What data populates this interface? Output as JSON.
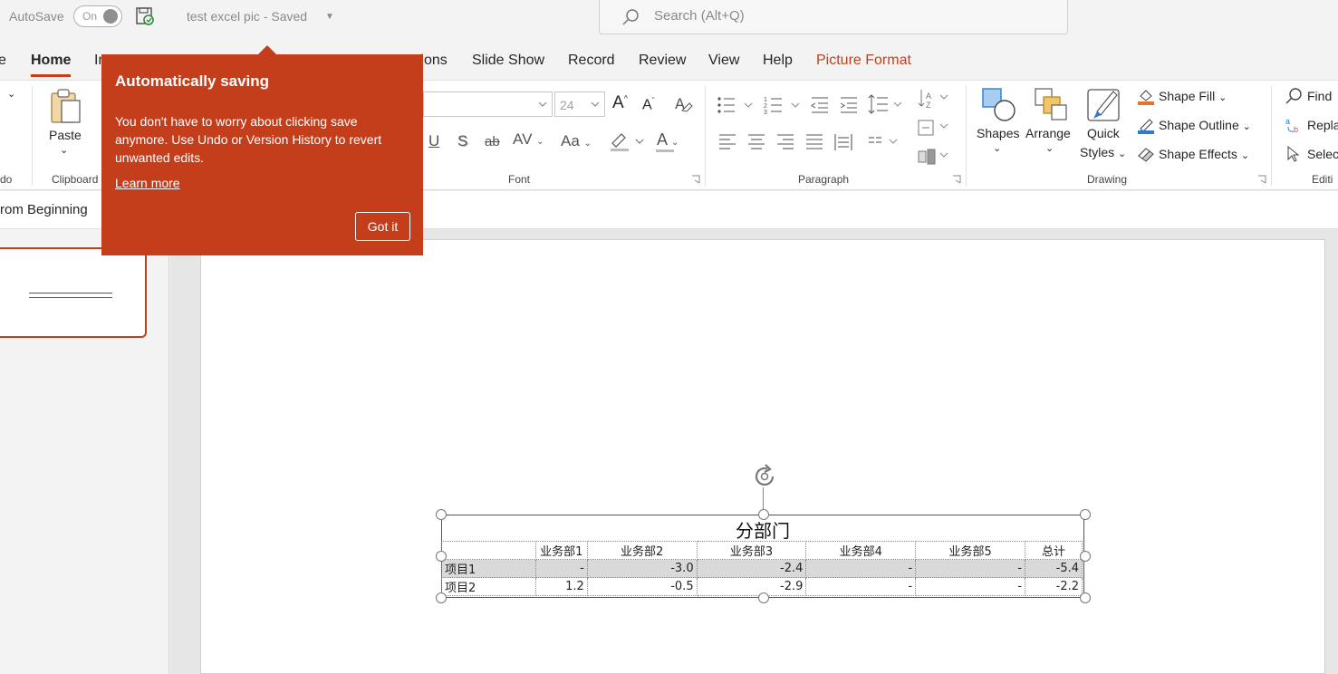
{
  "titlebar": {
    "autosave_label": "AutoSave",
    "autosave_state": "On",
    "doc_title": "test excel pic  -  Saved",
    "search_placeholder": "Search (Alt+Q)"
  },
  "tabs": [
    {
      "label": "e"
    },
    {
      "label": "Home"
    },
    {
      "label": "In"
    },
    {
      "label": "tions"
    },
    {
      "label": "Slide Show"
    },
    {
      "label": "Record"
    },
    {
      "label": "Review"
    },
    {
      "label": "View"
    },
    {
      "label": "Help"
    },
    {
      "label": "Picture Format"
    }
  ],
  "ribbon": {
    "groups": {
      "undo": "do",
      "clipboard": "Clipboard",
      "font": "Font",
      "paragraph": "Paragraph",
      "drawing": "Drawing",
      "editing": "Editi"
    },
    "paste_label": "Paste",
    "font_size": "24",
    "font_buttons": {
      "underline": "U",
      "shadow": "S",
      "strike": "ab",
      "spacing": "AV",
      "case": "Aa",
      "color": "A",
      "grow": "A",
      "shrink": "A"
    },
    "shapes_label": "Shapes",
    "arrange_label": "Arrange",
    "quick_styles_line1": "Quick",
    "quick_styles_line2": "Styles",
    "shape_fill": "Shape Fill",
    "shape_outline": "Shape Outline",
    "shape_effects": "Shape Effects",
    "find": "Find",
    "replace": "Repla",
    "select": "Selec"
  },
  "qbar": {
    "from_beginning": "rom Beginning"
  },
  "table": {
    "title": "分部门",
    "headers": [
      "",
      "业务部1",
      "业务部2",
      "业务部3",
      "业务部4",
      "业务部5",
      "总计"
    ],
    "rows": [
      [
        "项目1",
        "-",
        "-3.0",
        "-2.4",
        "-",
        "-",
        "-5.4"
      ],
      [
        "项目2",
        "1.2",
        "-0.5",
        "-2.9",
        "-",
        "-",
        "-2.2"
      ]
    ]
  },
  "callout": {
    "title": "Automatically saving",
    "body": "You don't have to worry about clicking save anymore. Use Undo or Version History to revert unwanted edits.",
    "link": "Learn more",
    "button": "Got it"
  },
  "colors": {
    "accent": "#c43e1c",
    "callout_bg": "#c43e1c",
    "ribbon_bg": "#ffffff"
  }
}
